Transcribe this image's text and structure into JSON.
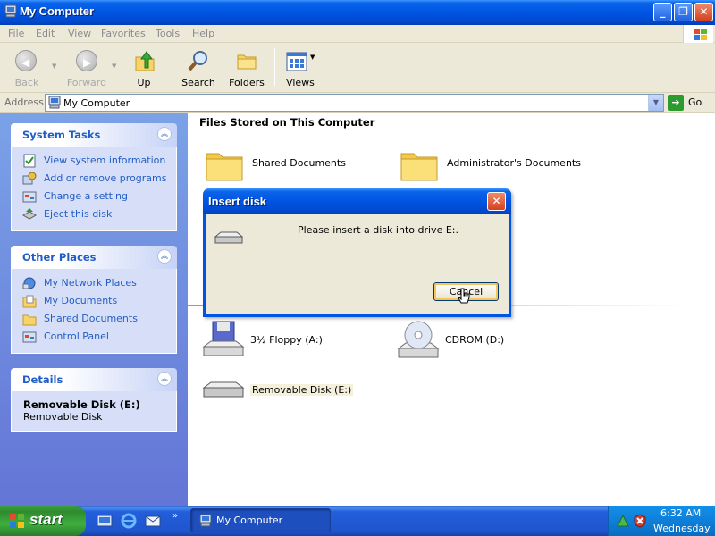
{
  "window": {
    "title": "My Computer"
  },
  "menu": [
    "File",
    "Edit",
    "View",
    "Favorites",
    "Tools",
    "Help"
  ],
  "toolbar": {
    "back": "Back",
    "forward": "Forward",
    "up": "Up",
    "search": "Search",
    "folders": "Folders",
    "views": "Views"
  },
  "address": {
    "label": "Address",
    "value": "My Computer",
    "go": "Go"
  },
  "system_tasks": {
    "title": "System Tasks",
    "items": [
      "View system information",
      "Add or remove programs",
      "Change a setting",
      "Eject this disk"
    ]
  },
  "other_places": {
    "title": "Other Places",
    "items": [
      "My Network Places",
      "My Documents",
      "Shared Documents",
      "Control Panel"
    ]
  },
  "details": {
    "title": "Details",
    "name": "Removable Disk (E:)",
    "type": "Removable Disk"
  },
  "content": {
    "heading": "Files Stored on This Computer",
    "folders": [
      "Shared Documents",
      "Administrator's Documents"
    ],
    "drives": [
      "3½ Floppy (A:)",
      "CDROM (D:)",
      "Removable Disk (E:)"
    ]
  },
  "dialog": {
    "title": "Insert disk",
    "message": "Please insert a disk into drive E:.",
    "cancel": "Cancel"
  },
  "taskbar": {
    "start": "start",
    "task": "My Computer",
    "time": "6:32 AM",
    "day": "Wednesday"
  },
  "colors": {
    "title_blue": "#0054e3",
    "task_link": "#215dc6",
    "start_green": "#3c9e3c",
    "tray_blue": "#0f7fd9"
  }
}
